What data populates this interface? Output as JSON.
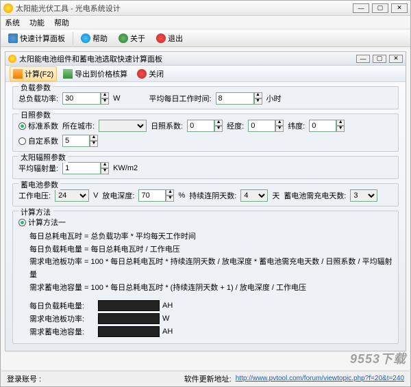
{
  "window": {
    "title": "太阳能光伏工具 - 光电系统设计"
  },
  "menubar": {
    "system": "系统",
    "function": "功能",
    "help": "帮助"
  },
  "toolbar": {
    "quick_calc": "快速计算面板",
    "help": "帮助",
    "about": "关于",
    "exit": "退出"
  },
  "panel": {
    "title": "太阳能电池组件和蓄电池选取快速计算面板",
    "compute": "计算(F2)",
    "export": "导出到价格核算",
    "close": "关闭"
  },
  "load": {
    "legend": "负载参数",
    "total_power_label": "总负载功率:",
    "total_power": "30",
    "watt": "W",
    "work_hours_label": "平均每日工作时间:",
    "work_hours": "8",
    "hours": "小时"
  },
  "sun": {
    "legend": "日照参数",
    "std_coef": "标准系数",
    "city_label": "所在城市:",
    "sun_coef_label": "日照系数:",
    "sun_coef": "0",
    "lon_label": "经度:",
    "lon": "0",
    "lat_label": "纬度:",
    "lat": "0",
    "custom_coef": "自定系数",
    "custom_value": "5"
  },
  "radiation": {
    "legend": "太阳辐照参数",
    "avg_label": "平均辐射量:",
    "avg": "1",
    "unit": "KW/m2"
  },
  "battery": {
    "legend": "蓄电池参数",
    "voltage_label": "工作电压:",
    "voltage": "24",
    "v": "V",
    "dod_label": "放电深度:",
    "dod": "70",
    "pct": "%",
    "cloudy_label": "持续连阴天数:",
    "cloudy": "4",
    "days": "天",
    "charge_label": "蓄电池需充电天数:",
    "charge": "3"
  },
  "method": {
    "legend": "计算方法",
    "opt1": "计算方法一",
    "line1": "每日总耗电瓦时 = 总负载功率 * 平均每天工作时间",
    "line2": "每日负载耗电量 = 每日总耗电瓦时 / 工作电压",
    "line3": "需求电池板功率 = 100 * 每日总耗电瓦时 * 持续连阴天数 / 放电深度 * 蓄电池需充电天数 / 日照系数 / 平均辐射量",
    "line4": "需求蓄电池容量 = 100 * 每日总耗电瓦时 * (持续连阴天数 + 1) / 放电深度 / 工作电压",
    "r1_label": "每日负载耗电量:",
    "r1_unit": "AH",
    "r2_label": "需求电池板功率:",
    "r2_unit": "W",
    "r3_label": "需求蓄电池容量:",
    "r3_unit": "AH"
  },
  "status": {
    "login_label": "登录账号 :",
    "update_label": "软件更新地址:",
    "update_url": "http://www.pvtool.com/forum/viewtopic.php?f=20&t=240"
  },
  "watermark": "9553下载"
}
